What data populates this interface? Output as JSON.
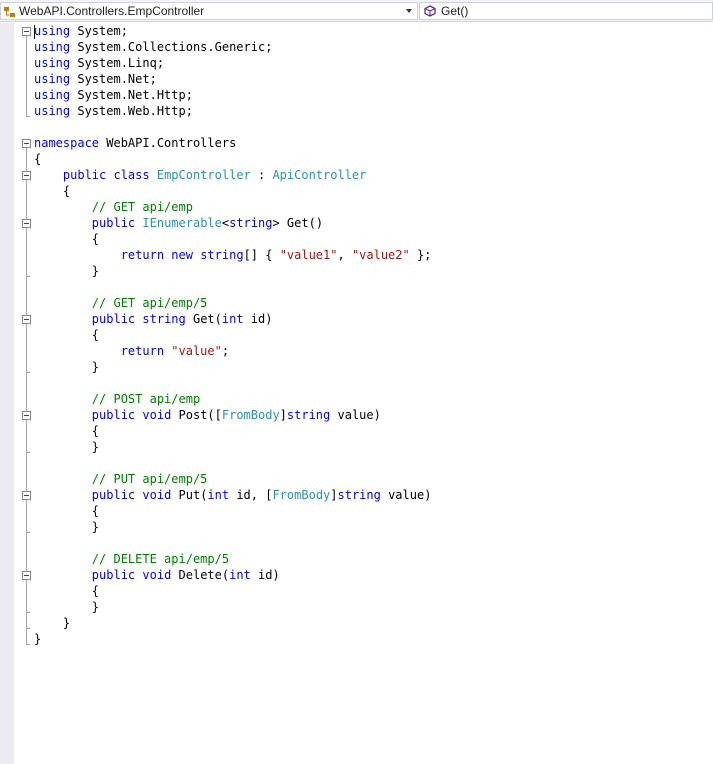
{
  "nav": {
    "class_dropdown": "WebAPI.Controllers.EmpController",
    "member_dropdown": "Get()"
  },
  "code": {
    "l1": {
      "a": "using",
      "b": " System;"
    },
    "l2": {
      "a": "using",
      "b": " System.Collections.Generic;"
    },
    "l3": {
      "a": "using",
      "b": " System.Linq;"
    },
    "l4": {
      "a": "using",
      "b": " System.Net;"
    },
    "l5": {
      "a": "using",
      "b": " System.Net.Http;"
    },
    "l6": {
      "a": "using",
      "b": " System.Web.Http;"
    },
    "l8": {
      "a": "namespace",
      "b": " WebAPI.Controllers"
    },
    "l9": "{",
    "l10": {
      "a": "    public",
      "b": " ",
      "c": "class",
      "d": " ",
      "e": "EmpController",
      "f": " : ",
      "g": "ApiController"
    },
    "l11": "    {",
    "l12": "        // GET api/emp",
    "l13": {
      "a": "        public",
      "b": " ",
      "c": "IEnumerable",
      "d": "<",
      "e": "string",
      "f": "> Get()"
    },
    "l14": "        {",
    "l15": {
      "a": "            return",
      "b": " ",
      "c": "new",
      "d": " ",
      "e": "string",
      "f": "[] { ",
      "g": "\"value1\"",
      "h": ", ",
      "i": "\"value2\"",
      "j": " };"
    },
    "l16": "        }",
    "l18": "        // GET api/emp/5",
    "l19": {
      "a": "        public",
      "b": " ",
      "c": "string",
      "d": " Get(",
      "e": "int",
      "f": " id)"
    },
    "l20": "        {",
    "l21": {
      "a": "            return",
      "b": " ",
      "c": "\"value\"",
      "d": ";"
    },
    "l22": "        }",
    "l24": "        // POST api/emp",
    "l25": {
      "a": "        public",
      "b": " ",
      "c": "void",
      "d": " Post([",
      "e": "FromBody",
      "f": "]",
      "g": "string",
      "h": " value)"
    },
    "l26": "        {",
    "l27": "        }",
    "l29": "        // PUT api/emp/5",
    "l30": {
      "a": "        public",
      "b": " ",
      "c": "void",
      "d": " Put(",
      "e": "int",
      "f": " id, [",
      "g": "FromBody",
      "h": "]",
      "i": "string",
      "j": " value)"
    },
    "l31": "        {",
    "l32": "        }",
    "l34": "        // DELETE api/emp/5",
    "l35": {
      "a": "        public",
      "b": " ",
      "c": "void",
      "d": " Delete(",
      "e": "int",
      "f": " id)"
    },
    "l36": "        {",
    "l37": "        }",
    "l38": "    }",
    "l39": "}"
  }
}
